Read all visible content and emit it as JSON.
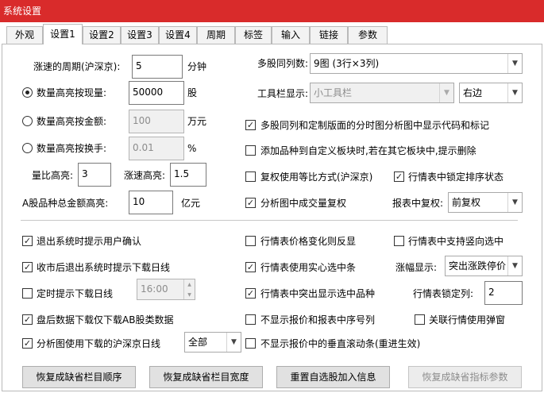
{
  "window": {
    "title": "系统设置"
  },
  "tabs": [
    "外观",
    "设置1",
    "设置2",
    "设置3",
    "设置4",
    "周期",
    "标签",
    "输入",
    "链接",
    "参数"
  ],
  "left": {
    "speed_period": {
      "label": "涨速的周期(沪深京):",
      "value": "5",
      "unit": "分钟"
    },
    "radios": [
      {
        "label": "数量高亮按现量:",
        "value": "50000",
        "unit": "股",
        "selected": true
      },
      {
        "label": "数量高亮按金额:",
        "value": "100",
        "unit": "万元",
        "selected": false
      },
      {
        "label": "数量高亮按换手:",
        "value": "0.01",
        "unit": "%",
        "selected": false
      }
    ],
    "volume_ratio": {
      "label": "量比高亮:",
      "value": "3"
    },
    "speed_highlight": {
      "label": "涨速高亮:",
      "value": "1.5"
    },
    "a_share_amount": {
      "label": "A股品种总金额高亮:",
      "value": "10",
      "unit": "亿元"
    }
  },
  "right": {
    "multi_cols": {
      "label": "多股同列数:",
      "value": "9图 (3行×3列)"
    },
    "toolbar": {
      "label": "工具栏显示:",
      "value": "小工具栏",
      "position": "右边"
    },
    "checks": [
      {
        "label": "多股同列和定制版面的分时图分析图中显示代码和标记",
        "checked": true
      },
      {
        "label": "添加品种到自定义板块时,若在其它板块中,提示删除",
        "checked": false
      },
      {
        "label": "复权使用等比方式(沪深京)",
        "checked": false
      },
      {
        "label": "行情表中锁定排序状态",
        "checked": true
      },
      {
        "label": "分析图中成交量复权",
        "checked": true
      }
    ],
    "report_adjust": {
      "label": "报表中复权:",
      "value": "前复权"
    }
  },
  "bottom_left": [
    {
      "label": "退出系统时提示用户确认",
      "checked": true
    },
    {
      "label": "收市后退出系统时提示下载日线",
      "checked": true
    },
    {
      "label": "定时提示下载日线",
      "checked": false,
      "time": "16:00"
    },
    {
      "label": "盘后数据下载仅下载AB股类数据",
      "checked": true
    },
    {
      "label": "分析图使用下载的沪深京日线",
      "checked": true,
      "select": "全部"
    }
  ],
  "bottom_right": [
    {
      "label": "行情表价格变化则反显",
      "checked": false
    },
    {
      "label": "行情表中支持竖向选中",
      "checked": false
    },
    {
      "label": "行情表使用实心选中条",
      "checked": true
    },
    {
      "label": "行情表中突出显示选中品种",
      "checked": true
    },
    {
      "label": "不显示报价和报表中序号列",
      "checked": false
    },
    {
      "label": "关联行情使用弹窗",
      "checked": false
    },
    {
      "label": "不显示报价中的垂直滚动条(重进生效)",
      "checked": false
    }
  ],
  "change_display": {
    "label": "涨幅显示:",
    "value": "突出涨跌停价"
  },
  "lock_cols": {
    "label": "行情表锁定列:",
    "value": "2"
  },
  "buttons": [
    "恢复成缺省栏目顺序",
    "恢复成缺省栏目宽度",
    "重置自选股加入信息",
    "恢复成缺省指标参数"
  ],
  "check_mark": "✓"
}
